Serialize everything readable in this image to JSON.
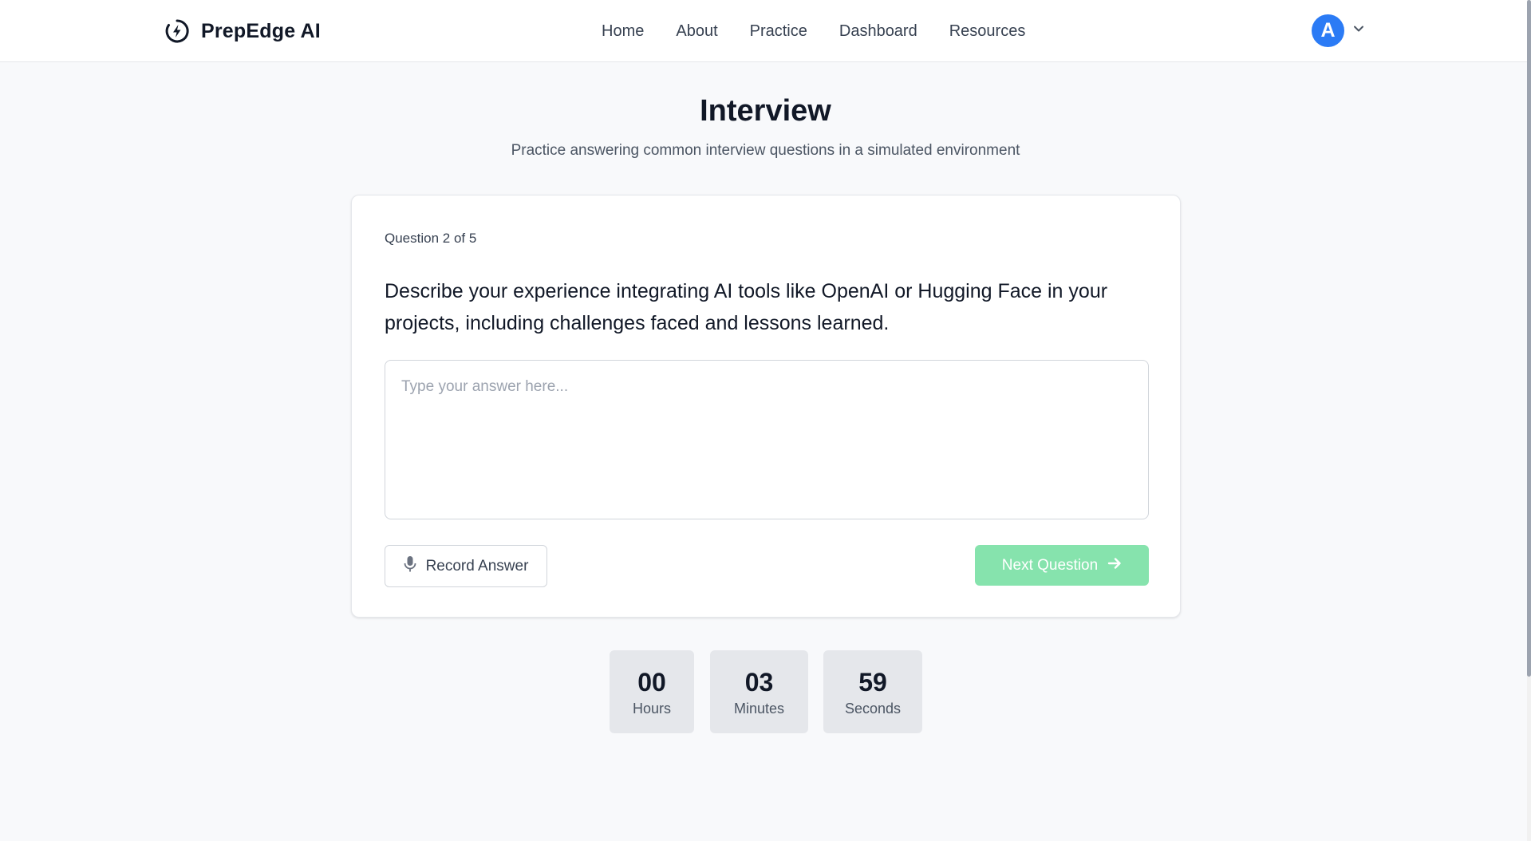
{
  "header": {
    "brand": "PrepEdge AI",
    "nav": [
      "Home",
      "About",
      "Practice",
      "Dashboard",
      "Resources"
    ],
    "avatar_initial": "A"
  },
  "page": {
    "title": "Interview",
    "subtitle": "Practice answering common interview questions in a simulated environment"
  },
  "card": {
    "counter": "Question 2 of 5",
    "question": "Describe your experience integrating AI tools like OpenAI or Hugging Face in your projects, including challenges faced and lessons learned.",
    "answer_placeholder": "Type your answer here...",
    "answer_value": "",
    "record_label": "Record Answer",
    "next_label": "Next Question"
  },
  "timer": {
    "hours": "00",
    "hours_label": "Hours",
    "minutes": "03",
    "minutes_label": "Minutes",
    "seconds": "59",
    "seconds_label": "Seconds"
  },
  "colors": {
    "accent_blue": "#2b7bf5",
    "next_button": "#86e3ad",
    "background": "#f8f9fb"
  },
  "icons": [
    "logo-icon",
    "chevron-down-icon",
    "microphone-icon",
    "arrow-right-icon"
  ]
}
